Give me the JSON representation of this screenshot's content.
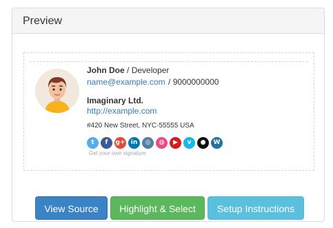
{
  "panel": {
    "title": "Preview"
  },
  "signature": {
    "name": "John Doe",
    "role": "Developer",
    "email": "name@example.com",
    "phone": "9000000000",
    "company": "Imaginary Ltd.",
    "website": "http://example.com",
    "address": "#420 New Street, NYC-55555 USA",
    "get_own": "Get your own signature",
    "socials": [
      {
        "name": "twitter-icon",
        "color": "#55acee",
        "glyph": "t"
      },
      {
        "name": "facebook-icon",
        "color": "#3b5998",
        "glyph": "f"
      },
      {
        "name": "google-plus-icon",
        "color": "#dd4b39",
        "glyph": "g+"
      },
      {
        "name": "linkedin-icon",
        "color": "#0077b5",
        "glyph": "in"
      },
      {
        "name": "instagram-icon",
        "color": "#517fa4",
        "glyph": "◎"
      },
      {
        "name": "dribbble-icon",
        "color": "#ea4c89",
        "glyph": "◍"
      },
      {
        "name": "youtube-icon",
        "color": "#cd201f",
        "glyph": "▶"
      },
      {
        "name": "vimeo-icon",
        "color": "#1ab7ea",
        "glyph": "v"
      },
      {
        "name": "github-icon",
        "color": "#111111",
        "glyph": "●"
      },
      {
        "name": "wordpress-icon",
        "color": "#21759b",
        "glyph": "W"
      }
    ]
  },
  "buttons": {
    "view_source": "View Source",
    "highlight_select": "Highlight & Select",
    "setup_instructions": "Setup Instructions"
  }
}
